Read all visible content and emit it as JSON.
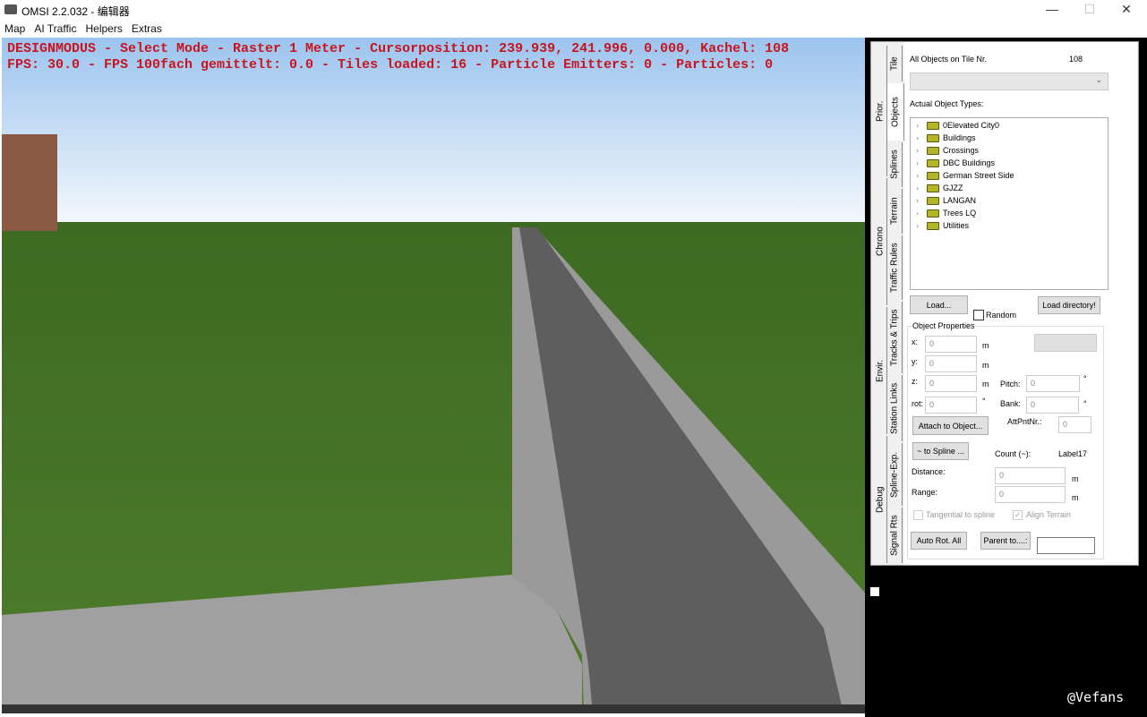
{
  "window": {
    "title": "OMSI 2.2.032 - 编辑器",
    "minimize": "—",
    "maximize": "☐",
    "close": "✕"
  },
  "menu": [
    "Map",
    "AI Traffic",
    "Helpers",
    "Extras"
  ],
  "hud": {
    "line1": "DESIGNMODUS - Select Mode - Raster 1 Meter - Cursorposition: 239.939, 241.996, 0.000, Kachel: 108",
    "line2": "FPS: 30.0 - FPS 100fach gemittelt: 0.0 - Tiles loaded: 16 - Particle Emitters: 0 - Particles: 0"
  },
  "tabs_outer": [
    "Prior.",
    "Chrono",
    "Envir.",
    "Debug"
  ],
  "tabs_inner": [
    "Tile",
    "Objects",
    "Splines",
    "Terrain",
    "Traffic Rules",
    "Tracks & Trips",
    "Station Links",
    "Spline-Exp.",
    "Signal Rts"
  ],
  "objects": {
    "all_objects_label": "All Objects on Tile Nr.",
    "tile_nr": "108",
    "types_label": "Actual Object Types:",
    "tree": [
      "0Elevated City0",
      "Buildings",
      "Crossings",
      "DBC Buildings",
      "German Street Side",
      "GJZZ",
      "LANGAN",
      "Trees LQ",
      "Utilities"
    ],
    "load": "Load...",
    "random": "Random",
    "load_dir": "Load directory!",
    "props_label": "Object Properties",
    "x_label": "x:",
    "y_label": "y:",
    "z_label": "z:",
    "rot_label": "rot:",
    "pitch_label": "Pitch:",
    "bank_label": "Bank:",
    "x": "0",
    "y": "0",
    "z": "0",
    "rot": "0",
    "pitch": "0",
    "bank": "0",
    "unit_m": "m",
    "unit_deg": "°",
    "attach": "Attach to Object...",
    "attpnt_label": "AttPntNr.:",
    "attpnt": "0",
    "to_spline": "~ to Spline ...",
    "count_label": "Count (~):",
    "count_value": "Label17",
    "distance_label": "Distance:",
    "distance": "0",
    "range_label": "Range:",
    "range": "0",
    "tangential": "Tangential to spline",
    "align_terrain": "Align Terrain",
    "auto_rot": "Auto Rot. All",
    "parent_to": "Parent to....:"
  },
  "watermark": "@Vefans"
}
